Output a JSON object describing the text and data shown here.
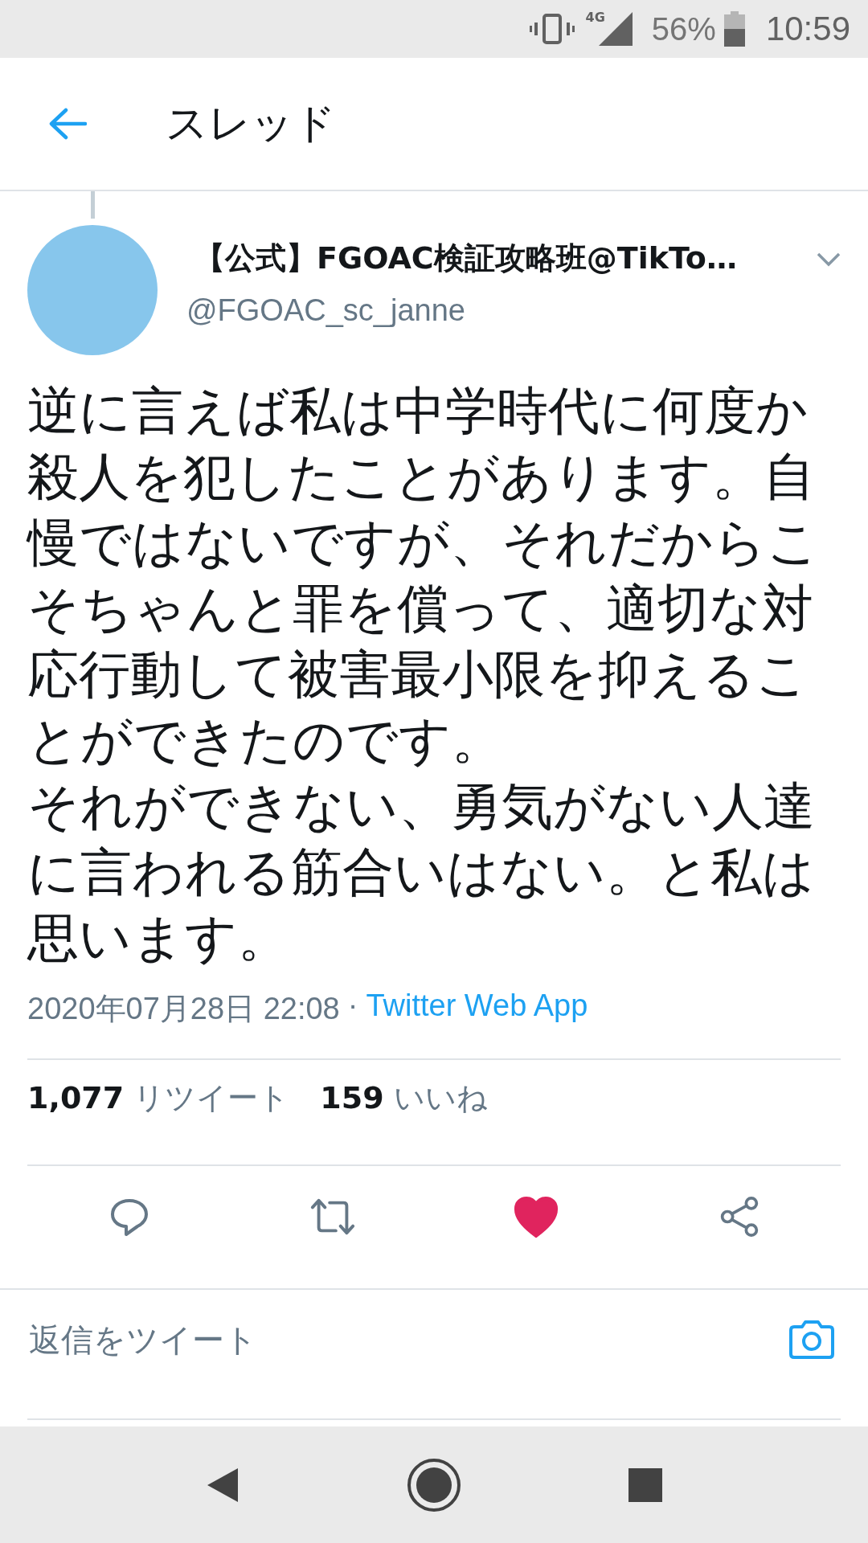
{
  "status_bar": {
    "network": "4G",
    "battery": "56%",
    "time": "10:59"
  },
  "header": {
    "title": "スレッド"
  },
  "tweet": {
    "display_name": "【公式】FGOAC検証攻略班@TikTo…",
    "handle": "@FGOAC_sc_janne",
    "paragraphs": [
      "逆に言えば私は中学時代に何度か殺人を犯したことがあります。自慢ではないですが、それだからこそちゃんと罪を償って、適切な対応行動して被害最小限を抑えることができたのです。",
      "それができない、勇気がない人達に言われる筋合いはない。と私は思います。"
    ],
    "timestamp": "2020年07月28日 22:08",
    "separator": "·",
    "source": "Twitter Web App",
    "stats": [
      {
        "count": "1,077",
        "label": "リツイート"
      },
      {
        "count": "159",
        "label": "いいね"
      }
    ],
    "liked": true
  },
  "reply": {
    "placeholder": "返信をツイート"
  }
}
